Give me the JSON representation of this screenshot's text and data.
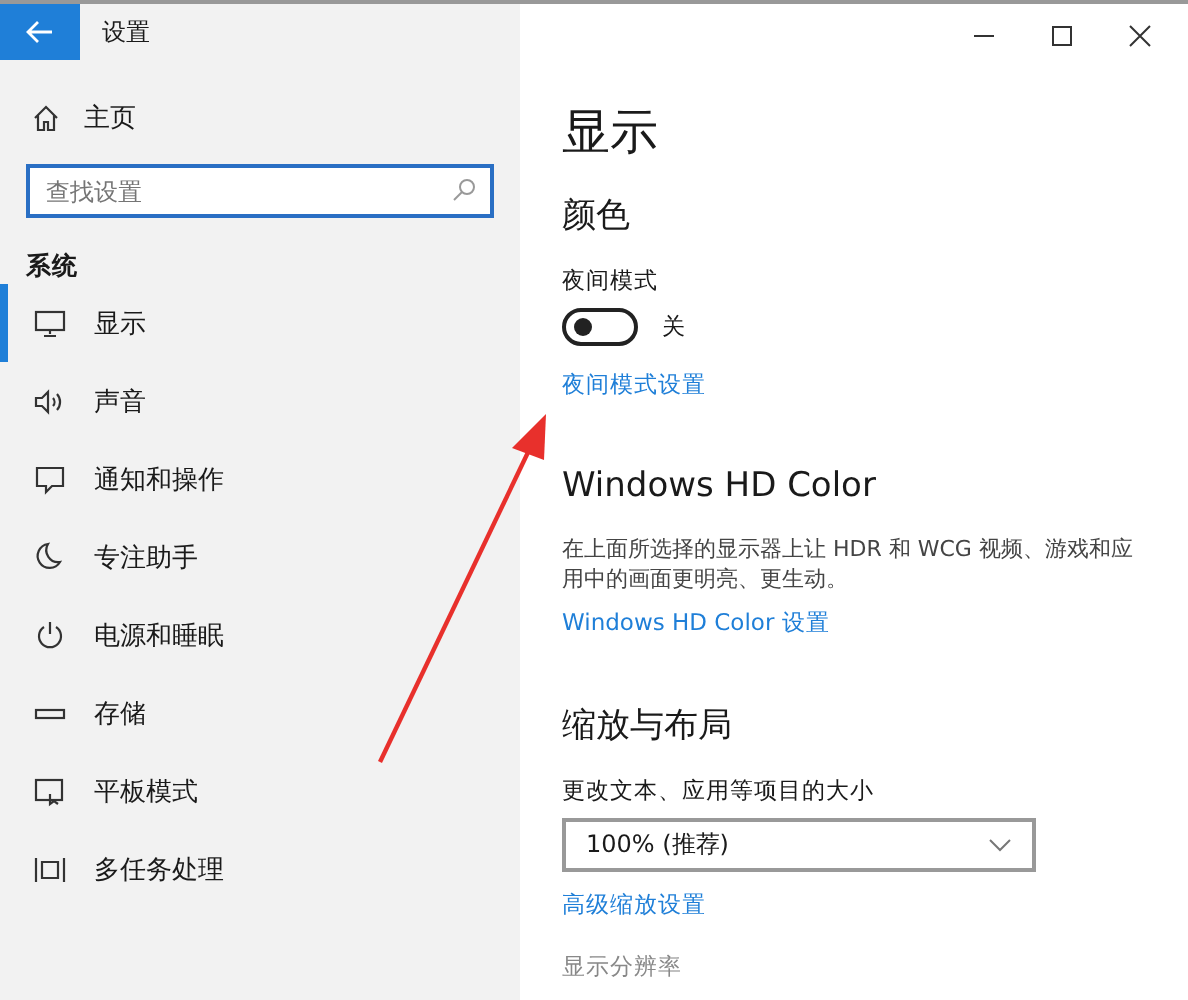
{
  "window": {
    "title": "设置"
  },
  "sidebar": {
    "home": "主页",
    "search": {
      "placeholder": "查找设置"
    },
    "section": "系统",
    "items": [
      {
        "label": "显示",
        "kind": "display",
        "selected": true
      },
      {
        "label": "声音",
        "kind": "sound",
        "selected": false
      },
      {
        "label": "通知和操作",
        "kind": "notify",
        "selected": false
      },
      {
        "label": "专注助手",
        "kind": "moon",
        "selected": false
      },
      {
        "label": "电源和睡眠",
        "kind": "power",
        "selected": false
      },
      {
        "label": "存储",
        "kind": "storage",
        "selected": false
      },
      {
        "label": "平板模式",
        "kind": "tablet",
        "selected": false
      },
      {
        "label": "多任务处理",
        "kind": "multitask",
        "selected": false
      }
    ]
  },
  "content": {
    "title": "显示",
    "color_heading": "颜色",
    "night_light": {
      "label": "夜间模式",
      "on": false,
      "state_text": "关",
      "link": "夜间模式设置"
    },
    "hd_color": {
      "heading": "Windows HD Color",
      "description": "在上面所选择的显示器上让 HDR 和 WCG 视频、游戏和应用中的画面更明亮、更生动。",
      "link": "Windows HD Color 设置"
    },
    "scale": {
      "heading": "缩放与布局",
      "size_label": "更改文本、应用等项目的大小",
      "dropdown": {
        "value": "100% (推荐)"
      },
      "link": "高级缩放设置",
      "resolution_label": "显示分辨率"
    }
  }
}
